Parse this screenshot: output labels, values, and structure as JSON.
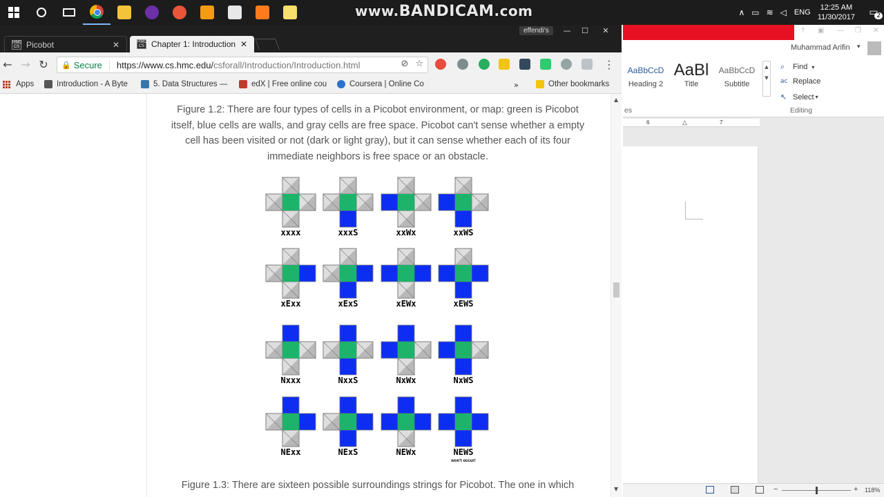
{
  "watermark": {
    "pre": "www.",
    "brand": "BANDICAM",
    "post": ".com"
  },
  "taskbar": {
    "icons": [
      "windows-start-icon",
      "cortana-icon",
      "task-view-icon",
      "chrome-icon",
      "file-explorer-icon",
      "security-icon",
      "app-icon",
      "media-player-icon",
      "java-icon",
      "sublime-icon",
      "sticky-notes-icon"
    ],
    "tray": {
      "chevron": "∧",
      "lang": "ENG",
      "time": "12:25 AM",
      "date": "11/30/2017",
      "notifications": "2"
    }
  },
  "browser": {
    "profile": "effendi's",
    "tabs": [
      {
        "label": "Picobot",
        "fav": "HMC CS",
        "close": "✕"
      },
      {
        "label": "Chapter 1: Introduction -",
        "fav": "HMC CS",
        "close": "✕"
      }
    ],
    "window_controls": {
      "min": "—",
      "max": "☐",
      "close": "✕"
    },
    "nav": {
      "back": "←",
      "forward": "→",
      "reload": "↻",
      "lock": "🔒"
    },
    "security_label": "Secure",
    "url_host": "https://www.cs.hmc.edu/",
    "url_path": "csforall/Introduction/Introduction.html",
    "star": "☆",
    "menu": "⋮",
    "bookmarks": [
      {
        "label": "Apps"
      },
      {
        "label": "Introduction - A Byte"
      },
      {
        "label": "5. Data Structures —"
      },
      {
        "label": "edX | Free online cou"
      },
      {
        "label": "Coursera | Online Co"
      }
    ],
    "bookmarks_overflow": "»",
    "other_bookmarks": "Other bookmarks"
  },
  "page": {
    "figure_1_2_caption": "Figure 1.2: There are four types of cells in a Picobot environment, or map: green is Picobot itself, blue cells are walls, and gray cells are free space. Picobot can't sense whether a empty cell has been visited or not (dark or light gray), but it can sense whether each of its four immediate neighbors is free space or an obstacle.",
    "figure_1_3_caption": "Figure 1.3: There are sixteen possible surroundings strings for Picobot. The one in which",
    "colors": {
      "robot": "#1db36a",
      "wall": "#0d2ef2",
      "free_dark": "#b8b8b8",
      "free_light": "#dedede"
    },
    "surroundings": [
      {
        "code": "xxxx",
        "n": false,
        "e": false,
        "w": false,
        "s": false
      },
      {
        "code": "xxxS",
        "n": false,
        "e": false,
        "w": false,
        "s": true
      },
      {
        "code": "xxWx",
        "n": false,
        "e": false,
        "w": true,
        "s": false
      },
      {
        "code": "xxWS",
        "n": false,
        "e": false,
        "w": true,
        "s": true
      },
      {
        "code": "xExx",
        "n": false,
        "e": true,
        "w": false,
        "s": false
      },
      {
        "code": "xExS",
        "n": false,
        "e": true,
        "w": false,
        "s": true
      },
      {
        "code": "xEWx",
        "n": false,
        "e": true,
        "w": true,
        "s": false
      },
      {
        "code": "xEWS",
        "n": false,
        "e": true,
        "w": true,
        "s": true
      },
      {
        "code": "Nxxx",
        "n": true,
        "e": false,
        "w": false,
        "s": false
      },
      {
        "code": "NxxS",
        "n": true,
        "e": false,
        "w": false,
        "s": true
      },
      {
        "code": "NxWx",
        "n": true,
        "e": false,
        "w": true,
        "s": false
      },
      {
        "code": "NxWS",
        "n": true,
        "e": false,
        "w": true,
        "s": true
      },
      {
        "code": "NExx",
        "n": true,
        "e": true,
        "w": false,
        "s": false
      },
      {
        "code": "NExS",
        "n": true,
        "e": true,
        "w": false,
        "s": true
      },
      {
        "code": "NEWx",
        "n": true,
        "e": true,
        "w": true,
        "s": false
      },
      {
        "code": "NEWS",
        "n": true,
        "e": true,
        "w": true,
        "s": true,
        "note": "won't occur!"
      }
    ]
  },
  "word": {
    "title_controls": {
      "help": "?",
      "ribbon_opts": "▣",
      "min": "—",
      "max": "❐",
      "close": "✕"
    },
    "user": "Muhammad Arifin",
    "styles": [
      {
        "sample": "AaBbCcD",
        "name": "Heading 2"
      },
      {
        "sample": "AaBl",
        "name": "Title"
      },
      {
        "sample": "AaBbCcD",
        "name": "Subtitle"
      }
    ],
    "styles_group_label": "es",
    "editing": [
      {
        "icon": "⌕",
        "label": "Find",
        "arrow": "▾"
      },
      {
        "icon": "ac",
        "label": "Replace",
        "arrow": ""
      },
      {
        "icon": "↖",
        "label": "Select",
        "arrow": "▾"
      }
    ],
    "editing_group_label": "Editing",
    "ruler": {
      "left": "6",
      "right": "7"
    },
    "zoom": "118%",
    "zoom_level": 0.5
  }
}
